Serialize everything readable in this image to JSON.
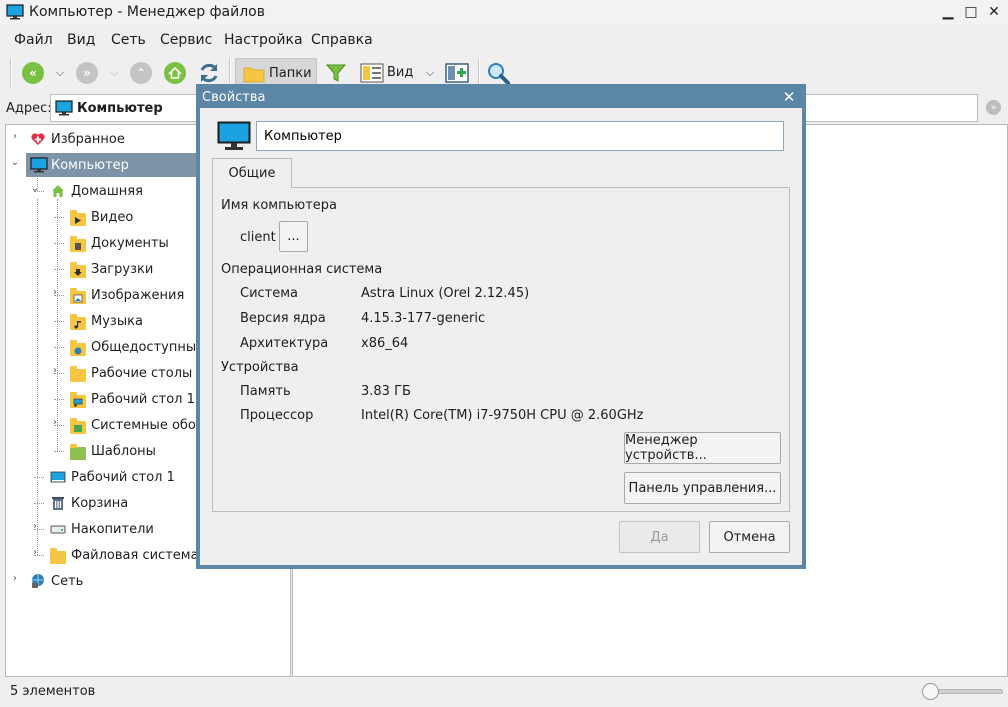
{
  "window": {
    "title": "Компьютер - Менеджер файлов",
    "minimize": "▁",
    "maximize": "□",
    "close": "✕"
  },
  "menu": [
    "Файл",
    "Вид",
    "Сеть",
    "Сервис",
    "Настройка",
    "Справка"
  ],
  "toolbar": {
    "folders_label": "Папки",
    "view_label": "Вид"
  },
  "address": {
    "label": "Адрес:",
    "value": "Компьютер"
  },
  "tree": [
    {
      "label": "Избранное",
      "icon": "heart-icon"
    },
    {
      "label": "Компьютер",
      "icon": "monitor-icon",
      "selected": true
    },
    {
      "label": "Домашняя",
      "icon": "home-icon"
    },
    {
      "label": "Видео",
      "icon": "folder-video-icon"
    },
    {
      "label": "Документы",
      "icon": "folder-documents-icon"
    },
    {
      "label": "Загрузки",
      "icon": "folder-downloads-icon"
    },
    {
      "label": "Изображения",
      "icon": "folder-pictures-icon"
    },
    {
      "label": "Музыка",
      "icon": "folder-music-icon"
    },
    {
      "label": "Общедоступные",
      "icon": "folder-public-icon"
    },
    {
      "label": "Рабочие столы",
      "icon": "folder-icon"
    },
    {
      "label": "Рабочий стол 1",
      "icon": "folder-desktop-icon"
    },
    {
      "label": "Системные обои",
      "icon": "folder-wallpapers-icon"
    },
    {
      "label": "Шаблоны",
      "icon": "folder-templates-icon"
    },
    {
      "label": "Рабочий стол 1",
      "icon": "desktop-icon"
    },
    {
      "label": "Корзина",
      "icon": "trash-icon"
    },
    {
      "label": "Накопители",
      "icon": "drive-icon"
    },
    {
      "label": "Файловая система",
      "icon": "folder-icon"
    },
    {
      "label": "Сеть",
      "icon": "network-icon"
    }
  ],
  "status": {
    "text": "5 элементов",
    "zoom": 0.0
  },
  "dialog": {
    "title": "Свойства",
    "close": "✕",
    "name_value": "Компьютер",
    "tab": "Общие",
    "computer_name_label": "Имя компьютера",
    "computer_name": "client",
    "browse_button": "...",
    "os_section": "Операционная система",
    "os_rows": [
      {
        "key": "Система",
        "value": "Astra Linux (Orel 2.12.45)"
      },
      {
        "key": "Версия ядра",
        "value": "4.15.3-177-generic"
      },
      {
        "key": "Архитектура",
        "value": "x86_64"
      }
    ],
    "devices_section": "Устройства",
    "device_rows": [
      {
        "key": "Память",
        "value": "3.83 ГБ"
      },
      {
        "key": "Процессор",
        "value": "Intel(R) Core(TM) i7-9750H CPU @ 2.60GHz"
      }
    ],
    "device_manager_button": "Менеджер устройств...",
    "control_panel_button": "Панель управления...",
    "ok_button": "Да",
    "cancel_button": "Отмена"
  },
  "colors": {
    "accent": "#5b86a6",
    "selection": "#7c93a8",
    "nav_green": "#7bc043",
    "nav_gray": "#bdbdbd"
  }
}
